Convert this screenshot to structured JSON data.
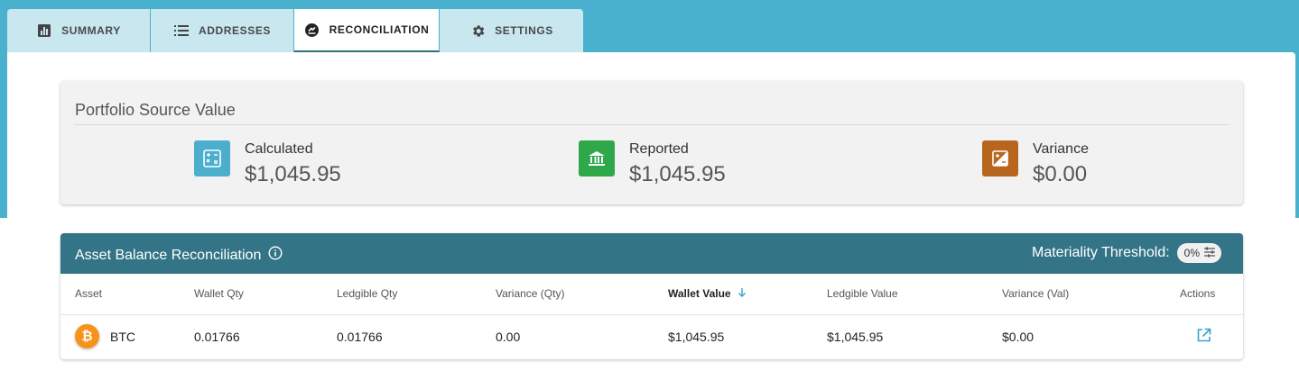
{
  "tabs": [
    {
      "label": "SUMMARY",
      "icon": "bar-chart-icon"
    },
    {
      "label": "ADDRESSES",
      "icon": "list-icon"
    },
    {
      "label": "RECONCILIATION",
      "icon": "reconcile-icon"
    },
    {
      "label": "SETTINGS",
      "icon": "gear-icon"
    }
  ],
  "active_tab": "RECONCILIATION",
  "source_value": {
    "title": "Portfolio Source Value",
    "stats": [
      {
        "label": "Calculated",
        "value": "$1,045.95",
        "icon": "calculator-icon",
        "color": "#4aaecc"
      },
      {
        "label": "Reported",
        "value": "$1,045.95",
        "icon": "bank-icon",
        "color": "#2ea84a"
      },
      {
        "label": "Variance",
        "value": "$0.00",
        "icon": "difference-icon",
        "color": "#b8651d"
      }
    ]
  },
  "reconciliation": {
    "title": "Asset Balance Reconciliation",
    "materiality_label": "Materiality Threshold:",
    "materiality_value": "0%",
    "columns": [
      "Asset",
      "Wallet Qty",
      "Ledgible Qty",
      "Variance (Qty)",
      "Wallet Value",
      "Ledgible Value",
      "Variance (Val)",
      "Actions"
    ],
    "sorted_column": "Wallet Value",
    "rows": [
      {
        "asset": "BTC",
        "wallet_qty": "0.01766",
        "ledgible_qty": "0.01766",
        "variance_qty": "0.00",
        "wallet_value": "$1,045.95",
        "ledgible_value": "$1,045.95",
        "variance_val": "$0.00"
      }
    ]
  },
  "colors": {
    "header_band": "#49b0ce",
    "table_header": "#337586",
    "bitcoin": "#f7931a",
    "link": "#3aa3c9"
  }
}
